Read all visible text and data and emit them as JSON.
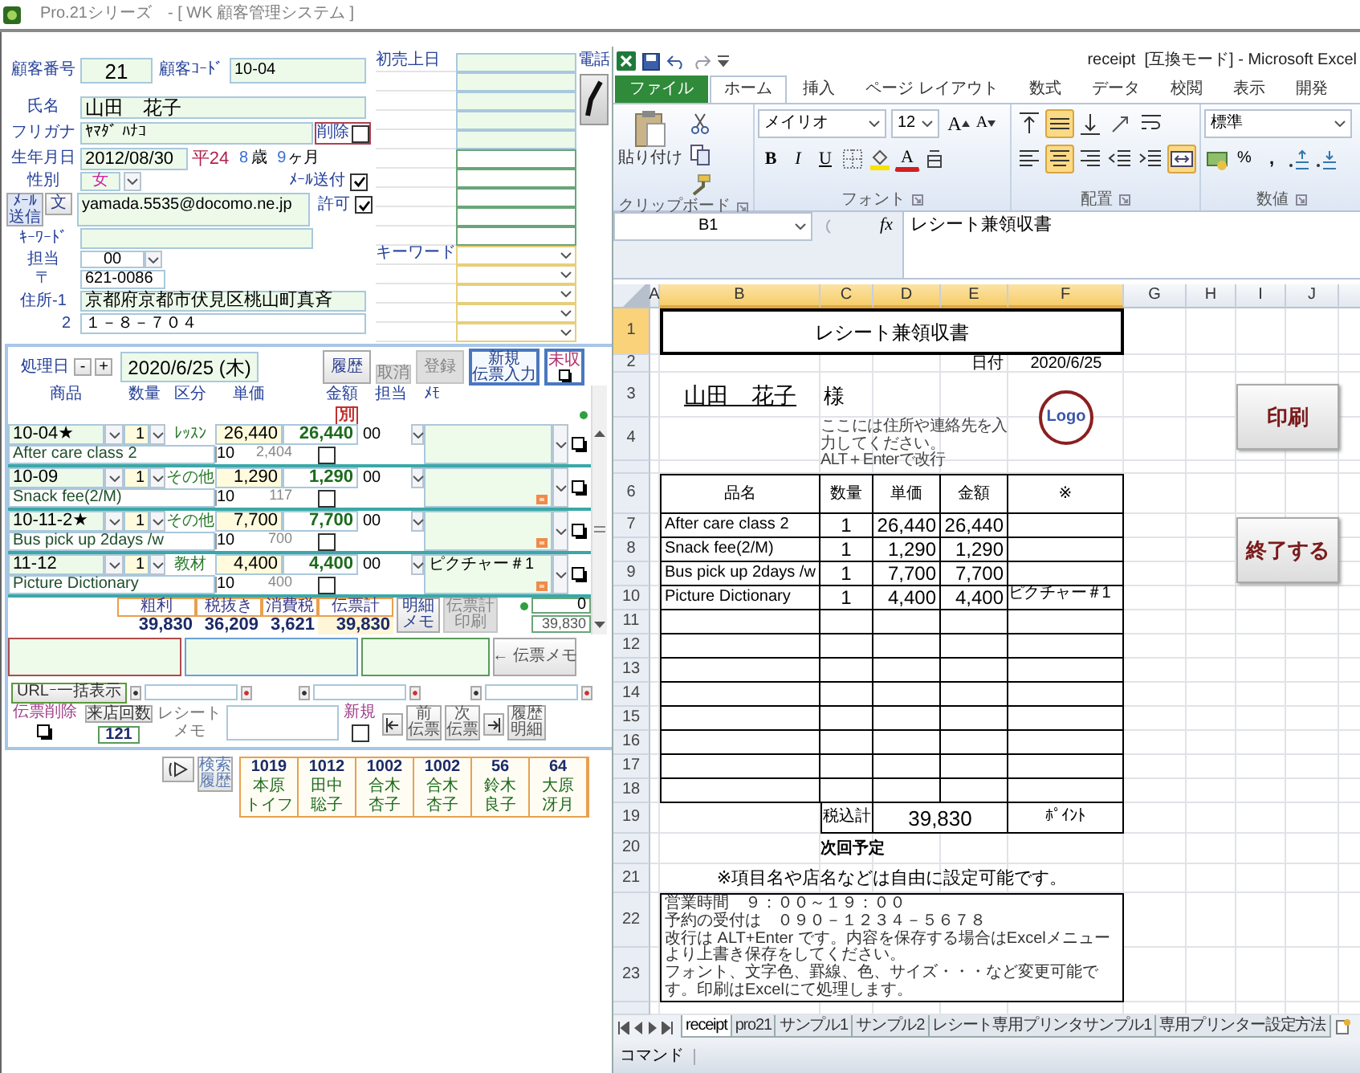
{
  "title_bar": {
    "title": "Pro.21シリーズ　- [ WK 顧客管理システム ]"
  },
  "customer": {
    "number_label": "顧客番号",
    "number": "21",
    "code_label": "顧客ｺｰﾄﾞ",
    "code": "10-04",
    "name_label": "氏名",
    "name": "山田　花子",
    "kana_label": "フリガナ",
    "kana": "ﾔﾏﾀﾞ ﾊﾅｺ",
    "delete": {
      "label": "削除",
      "checked": false
    },
    "birth_label": "生年月日",
    "birth": "2012/08/30",
    "era": "平24",
    "age_years": "8",
    "years_unit": "歳",
    "age_months": "9",
    "months_unit": "ヶ月",
    "gender_label": "性別",
    "gender": "女",
    "mail_send": {
      "label": "ﾒｰﾙ送付",
      "checked": true
    },
    "mail_button": "ﾒｰﾙ送信",
    "text_button": "文",
    "email": "yamada.5535@docomo.ne.jp",
    "permit": {
      "label": "許可",
      "checked": true
    },
    "keyword_label": "ｷｰﾜｰﾄﾞ",
    "staff_label": "担当",
    "staff": "00",
    "zip_label": "〒",
    "zip": "621-0086",
    "address1_label": "住所-1",
    "address1": "京都府京都市伏見区桃山町真斉",
    "address2_label": "2",
    "address2": "１－８－７０４",
    "first_sale_label": "初売上日",
    "keyword2_label": "キーワード",
    "phone_label": "電話"
  },
  "sales": {
    "date_label": "処理日",
    "decrement": "-",
    "increment": "+",
    "date": "2020/6/25 (木)",
    "buttons": [
      {
        "label": "履歴",
        "kind": "plain",
        "disabled": false
      },
      {
        "label": "取消",
        "kind": "small",
        "disabled": true
      },
      {
        "label": "登録",
        "kind": "plain",
        "disabled": true
      },
      {
        "label": [
          "新規",
          "伝票入力"
        ],
        "kind": "primary",
        "disabled": false
      },
      {
        "label": "未収",
        "kind": "icon",
        "disabled": false
      }
    ],
    "columns": [
      "商品",
      "数量",
      "区分",
      "単価",
      "金額",
      "担当",
      "ﾒﾓ"
    ],
    "tax_badge": "別",
    "items": [
      {
        "code": "10-04★",
        "qty": "1",
        "category": "ﾚｯｽﾝ",
        "price": "26,440",
        "amount": "26,440",
        "staff": "00",
        "name": "After care class 2",
        "tax_rate": "10",
        "tax": "2,404",
        "checked": false,
        "flag": false
      },
      {
        "code": "10-09",
        "qty": "1",
        "category": "その他",
        "price": "1,290",
        "amount": "1,290",
        "staff": "00",
        "name": "Snack fee(2/M)",
        "tax_rate": "10",
        "tax": "117",
        "checked": false,
        "flag": true
      },
      {
        "code": "10-11-2★",
        "qty": "1",
        "category": "その他",
        "price": "7,700",
        "amount": "7,700",
        "staff": "00",
        "name": "Bus pick up 2days /w",
        "tax_rate": "10",
        "tax": "700",
        "checked": false,
        "flag": true
      },
      {
        "code": "11-12",
        "qty": "1",
        "category": "教材",
        "price": "4,400",
        "amount": "4,400",
        "staff": "00",
        "memo": "ピクチャー＃1",
        "name": "Picture Dictionary",
        "tax_rate": "10",
        "tax": "400",
        "checked": false,
        "flag": true
      }
    ],
    "totals": [
      {
        "label": "粗利",
        "value": "39,830"
      },
      {
        "label": "税抜き",
        "value": "36,209"
      },
      {
        "label": "消費税",
        "value": "3,621"
      },
      {
        "label": "伝票計",
        "value": "39,830"
      }
    ],
    "detail_memo_button": [
      "明細",
      "メモ"
    ],
    "print_total_button": {
      "label": [
        "伝票計",
        "印刷"
      ],
      "disabled": true
    },
    "count": "0",
    "sum": "39,830",
    "memo_button": "← 伝票メモ",
    "url_button": "URLｰ一括表示",
    "delete_slip_label": "伝票削除",
    "visits_button": "来店回数",
    "visits": "121",
    "receipt_memo_label": [
      "レシート",
      "メモ"
    ],
    "new_slip": {
      "label": "新規",
      "checked": false
    },
    "prev_button": [
      "前",
      "伝票"
    ],
    "next_button": [
      "次",
      "伝票"
    ],
    "history_detail_button": [
      "履歴",
      "明細"
    ],
    "search_history_button": [
      "検索",
      "履歴"
    ],
    "history": [
      {
        "code": "1019",
        "family_name": "本原",
        "given_name": "トイフ"
      },
      {
        "code": "1012",
        "family_name": "田中",
        "given_name": "聡子"
      },
      {
        "code": "1002",
        "family_name": "合木",
        "given_name": "杏子"
      },
      {
        "code": "1002",
        "family_name": "合木",
        "given_name": "杏子"
      },
      {
        "code": "56",
        "family_name": "鈴木",
        "given_name": "良子"
      },
      {
        "code": "64",
        "family_name": "大原",
        "given_name": "冴月"
      }
    ]
  },
  "excel": {
    "title": "receipt  [互換モード] - Microsoft Excel",
    "tabs": [
      {
        "label": "ファイル",
        "kind": "file",
        "selected": false
      },
      {
        "label": "ホーム",
        "kind": "tab",
        "selected": true
      },
      {
        "label": "挿入",
        "kind": "tab",
        "selected": false
      },
      {
        "label": "ページ レイアウト",
        "kind": "tab",
        "selected": false
      },
      {
        "label": "数式",
        "kind": "tab",
        "selected": false
      },
      {
        "label": "データ",
        "kind": "tab",
        "selected": false
      },
      {
        "label": "校閲",
        "kind": "tab",
        "selected": false
      },
      {
        "label": "表示",
        "kind": "tab",
        "selected": false
      },
      {
        "label": "開発",
        "kind": "tab",
        "selected": false
      }
    ],
    "clipboard": {
      "paste": "貼り付け",
      "label": "クリップボード"
    },
    "font": {
      "name": "メイリオ",
      "size": "12",
      "grow": "A",
      "shrink": "A",
      "bold": "B",
      "italic": "I",
      "underline": "U",
      "font_color_button": "A",
      "label": "フォント"
    },
    "alignment": {
      "label": "配置",
      "top_row": [
        {
          "kind": "align-top",
          "selected": false
        },
        {
          "kind": "align-middle",
          "selected": true
        },
        {
          "kind": "align-bottom",
          "selected": false
        },
        {
          "kind": "orientation",
          "selected": false
        },
        {
          "kind": "wrap-text",
          "selected": false
        }
      ],
      "bottom_row": [
        {
          "kind": "align-left",
          "selected": false
        },
        {
          "kind": "align-center",
          "selected": true
        },
        {
          "kind": "align-right",
          "selected": false
        },
        {
          "kind": "decrease-indent",
          "selected": false
        },
        {
          "kind": "increase-indent",
          "selected": false
        },
        {
          "kind": "merge-center",
          "selected": true
        }
      ]
    },
    "number": {
      "format": "標準",
      "percent": "%",
      "comma": ",",
      "label": "数値"
    },
    "name_box": "B1",
    "function_label": "fx",
    "formula": "レシート兼領収書",
    "columns": [
      {
        "label": "A",
        "selected": false
      },
      {
        "label": "B",
        "selected": true
      },
      {
        "label": "C",
        "selected": true
      },
      {
        "label": "D",
        "selected": true
      },
      {
        "label": "E",
        "selected": true
      },
      {
        "label": "F",
        "selected": true
      },
      {
        "label": "G",
        "selected": false
      },
      {
        "label": "H",
        "selected": false
      },
      {
        "label": "I",
        "selected": false
      },
      {
        "label": "J",
        "selected": false
      }
    ],
    "rows": [
      {
        "label": "1",
        "selected": true
      },
      {
        "label": "2",
        "selected": false
      },
      {
        "label": "3",
        "selected": false
      },
      {
        "label": "4",
        "selected": false
      },
      {
        "selected": false
      },
      {
        "label": "6",
        "selected": false
      },
      {
        "label": "7",
        "selected": false
      },
      {
        "label": "8",
        "selected": false
      },
      {
        "label": "9",
        "selected": false
      },
      {
        "label": "10",
        "selected": false
      },
      {
        "label": "11",
        "selected": false
      },
      {
        "label": "12",
        "selected": false
      },
      {
        "label": "13",
        "selected": false
      },
      {
        "label": "14",
        "selected": false
      },
      {
        "label": "15",
        "selected": false
      },
      {
        "label": "16",
        "selected": false
      },
      {
        "label": "17",
        "selected": false
      },
      {
        "label": "18",
        "selected": false
      },
      {
        "label": "19",
        "selected": false
      },
      {
        "label": "20",
        "selected": false
      },
      {
        "label": "21",
        "selected": false
      },
      {
        "label": "22",
        "selected": false
      },
      {
        "label": "23",
        "selected": false
      }
    ],
    "receipt": {
      "title": "レシート兼領収書",
      "date_label": "日付",
      "date": "2020/6/25",
      "customer": "山田　花子",
      "honorific": "様",
      "note_lines": [
        "ここには住所や連絡先を入力してください。",
        "ALT＋Enterで改行"
      ],
      "logo": "Logo",
      "headers": [
        "品名",
        "数量",
        "単価",
        "金額",
        "※"
      ],
      "items": [
        {
          "name": "After care class 2",
          "qty": "1",
          "price": "26,440",
          "amount": "26,440"
        },
        {
          "name": "Snack fee(2/M)",
          "qty": "1",
          "price": "1,290",
          "amount": "1,290"
        },
        {
          "name": "Bus pick up 2days /w",
          "qty": "1",
          "price": "7,700",
          "amount": "7,700"
        },
        {
          "name": "Picture Dictionary",
          "qty": "1",
          "price": "4,400",
          "amount": "4,400",
          "note": "ピクチャー＃1"
        }
      ],
      "total_label": "税込計",
      "total": "39,830",
      "points_label": "ﾎﾟｲﾝﾄ",
      "next_visit_label": "次回予定",
      "setting_note": "※項目名や店名などは自由に設定可能です。",
      "footer_lines": [
        "営業時間　９：００～１９：００",
        "予約の受付は　０９０－１２３４－５６７８",
        "改行は ALT+Enter です。内容を保存する場合はExcelメニューより上書き保存をしてください。",
        "フォント、文字色、罫線、色、サイズ・・・など変更可能です。印刷はExcelにて処理します。"
      ]
    },
    "buttons": [
      "印刷",
      "終了する"
    ],
    "sheet_tabs": [
      {
        "label": "receipt",
        "selected": true
      },
      {
        "label": "pro21",
        "selected": false
      },
      {
        "label": "サンプル1",
        "selected": false
      },
      {
        "label": "サンプル2",
        "selected": false
      },
      {
        "label": "レシート専用プリンタサンプル1",
        "selected": false
      },
      {
        "label": "専用プリンター設定方法",
        "selected": false
      }
    ],
    "status": "コマンド"
  }
}
